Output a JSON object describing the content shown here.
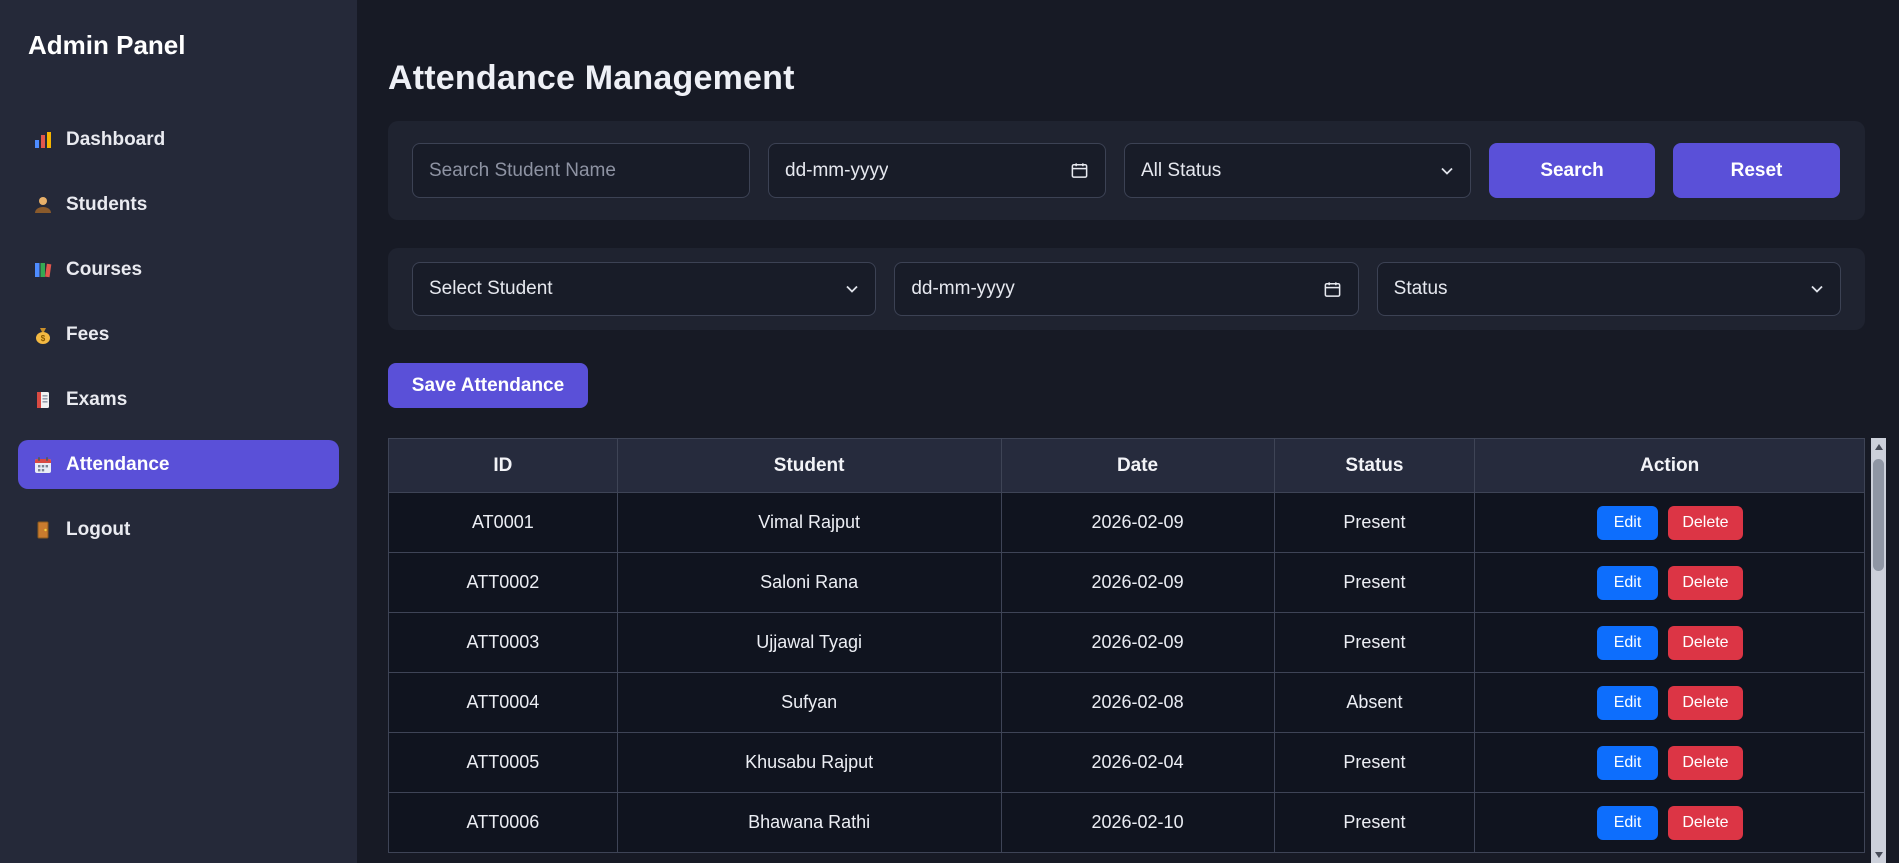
{
  "sidebar": {
    "title": "Admin Panel",
    "items": [
      {
        "label": "Dashboard",
        "icon": "dashboard-icon",
        "active": false
      },
      {
        "label": "Students",
        "icon": "students-icon",
        "active": false
      },
      {
        "label": "Courses",
        "icon": "courses-icon",
        "active": false
      },
      {
        "label": "Fees",
        "icon": "fees-icon",
        "active": false
      },
      {
        "label": "Exams",
        "icon": "exams-icon",
        "active": false
      },
      {
        "label": "Attendance",
        "icon": "attendance-icon",
        "active": true
      },
      {
        "label": "Logout",
        "icon": "logout-icon",
        "active": false
      }
    ]
  },
  "header": {
    "title": "Attendance Management"
  },
  "search_bar": {
    "name_placeholder": "Search Student Name",
    "date_placeholder": "dd-mm-yyyy",
    "status_selected": "All Status",
    "search_label": "Search",
    "reset_label": "Reset"
  },
  "entry_bar": {
    "student_selected": "Select Student",
    "date_placeholder": "dd-mm-yyyy",
    "status_selected": "Status",
    "save_label": "Save Attendance"
  },
  "table": {
    "headers": [
      "ID",
      "Student",
      "Date",
      "Status",
      "Action"
    ],
    "edit_label": "Edit",
    "delete_label": "Delete",
    "rows": [
      {
        "id": "AT0001",
        "student": "Vimal Rajput",
        "date": "2026-02-09",
        "status": "Present"
      },
      {
        "id": "ATT0002",
        "student": "Saloni Rana",
        "date": "2026-02-09",
        "status": "Present"
      },
      {
        "id": "ATT0003",
        "student": "Ujjawal Tyagi",
        "date": "2026-02-09",
        "status": "Present"
      },
      {
        "id": "ATT0004",
        "student": "Sufyan",
        "date": "2026-02-08",
        "status": "Absent"
      },
      {
        "id": "ATT0005",
        "student": "Khusabu Rajput",
        "date": "2026-02-04",
        "status": "Present"
      },
      {
        "id": "ATT0006",
        "student": "Bhawana Rathi",
        "date": "2026-02-10",
        "status": "Present"
      }
    ]
  },
  "colors": {
    "accent": "#5a50d8",
    "edit_button": "#0d6efd",
    "delete_button": "#dc3545",
    "page_bg": "#171a25",
    "sidebar_bg": "#252939",
    "card_bg": "#1f2330"
  }
}
